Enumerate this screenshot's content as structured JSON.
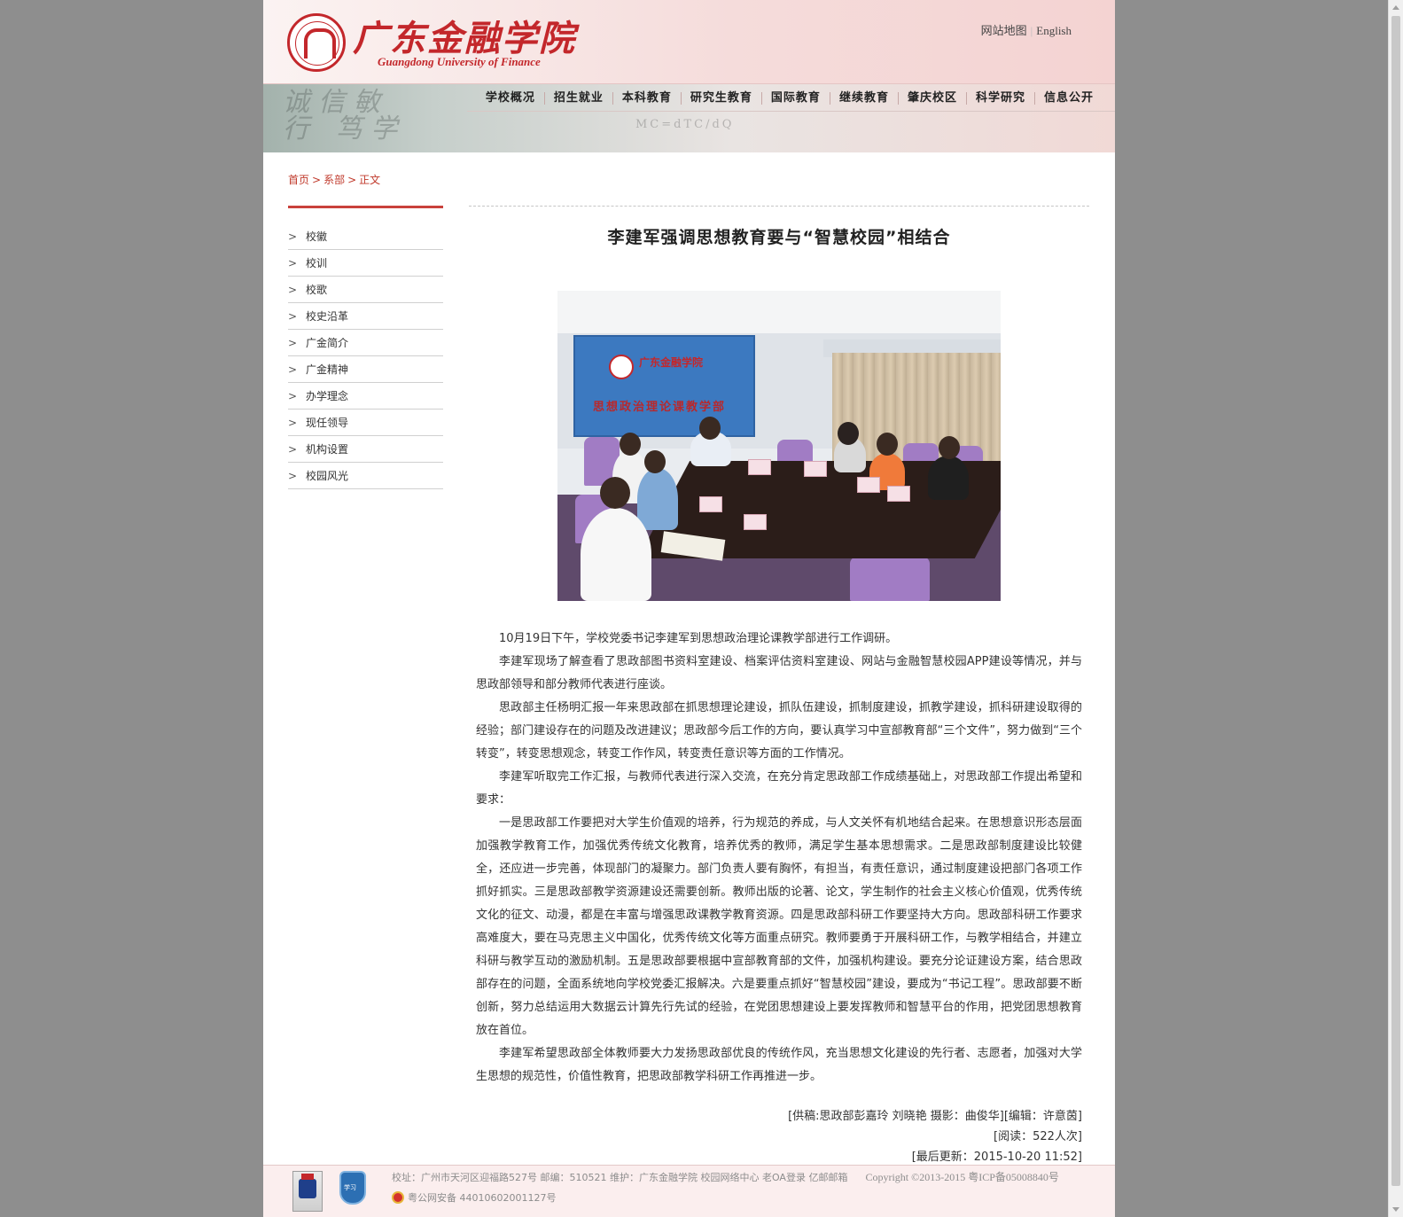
{
  "header": {
    "logo_cn": "广东金融学院",
    "logo_en": "Guangdong University of Finance",
    "top_links": [
      "网站地图",
      "English"
    ]
  },
  "banner": {
    "art_text": "诚信敏行 笃学"
  },
  "nav": [
    "学校概况",
    "招生就业",
    "本科教育",
    "研究生教育",
    "国际教育",
    "继续教育",
    "肇庆校区",
    "科学研究",
    "信息公开"
  ],
  "breadcrumb": [
    "首页",
    "系部",
    "正文"
  ],
  "sidebar": {
    "items": [
      "校徽",
      "校训",
      "校歌",
      "校史沿革",
      "广金简介",
      "广金精神",
      "办学理念",
      "现任领导",
      "机构设置",
      "校园风光"
    ]
  },
  "article": {
    "title": "李建军强调思想教育要与“智慧校园”相结合",
    "photo": {
      "board_title": "广东金融学院",
      "board_subtitle": "思想政治理论课教学部"
    },
    "paragraphs": [
      "10月19日下午，学校党委书记李建军到思想政治理论课教学部进行工作调研。",
      "李建军现场了解查看了思政部图书资料室建设、档案评估资料室建设、网站与金融智慧校园APP建设等情况，并与思政部领导和部分教师代表进行座谈。",
      "思政部主任杨明汇报一年来思政部在抓思想理论建设，抓队伍建设，抓制度建设，抓教学建设，抓科研建设取得的经验；部门建设存在的问题及改进建议；思政部今后工作的方向，要认真学习中宣部教育部“三个文件”，努力做到“三个转变”，转变思想观念，转变工作作风，转变责任意识等方面的工作情况。",
      "李建军听取完工作汇报，与教师代表进行深入交流，在充分肯定思政部工作成绩基础上，对思政部工作提出希望和要求：",
      "一是思政部工作要把对大学生价值观的培养，行为规范的养成，与人文关怀有机地结合起来。在思想意识形态层面加强教学教育工作，加强优秀传统文化教育，培养优秀的教师，满足学生基本思想需求。二是思政部制度建设比较健全，还应进一步完善，体现部门的凝聚力。部门负责人要有胸怀，有担当，有责任意识，通过制度建设把部门各项工作抓好抓实。三是思政部教学资源建设还需要创新。教师出版的论著、论文，学生制作的社会主义核心价值观，优秀传统文化的征文、动漫，都是在丰富与增强思政课教学教育资源。四是思政部科研工作要坚持大方向。思政部科研工作要求高难度大，要在马克思主义中国化，优秀传统文化等方面重点研究。教师要勇于开展科研工作，与教学相结合，并建立科研与教学互动的激励机制。五是思政部要根据中宣部教育部的文件，加强机构建设。要充分论证建设方案，结合思政部存在的问题，全面系统地向学校党委汇报解决。六是要重点抓好“智慧校园”建设，要成为“书记工程”。思政部要不断创新，努力总结运用大数据云计算先行先试的经验，在党团思想建设上要发挥教师和智慧平台的作用，把党团思想教育放在首位。",
      "李建军希望思政部全体教师要大力发扬思政部优良的传统作风，充当思想文化建设的先行者、志愿者，加强对大学生思想的规范性，价值性教育，把思政部教学科研工作再推进一步。"
    ],
    "meta": {
      "source": "[供稿:思政部彭嘉玲 刘晓艳 摄影：曲俊华][编辑：许意茵]",
      "views": "[阅读：522人次]",
      "updated": "[最后更新：2015-10-20 11:52]"
    }
  },
  "footer": {
    "line1": "校址：广州市天河区迎福路527号  邮编：510521  维护：广东金融学院  校园网络中心  老OA登录  亿邮邮箱",
    "copyright": "Copyright ©2013-2015 粤ICP备05008840号",
    "line2": "粤公网安备 44010602001127号",
    "badge2_text": "学习"
  },
  "colors": {
    "brand": "#c3272b",
    "breadcrumb": "#c0392b",
    "page_bg": "#8e8e8e"
  }
}
